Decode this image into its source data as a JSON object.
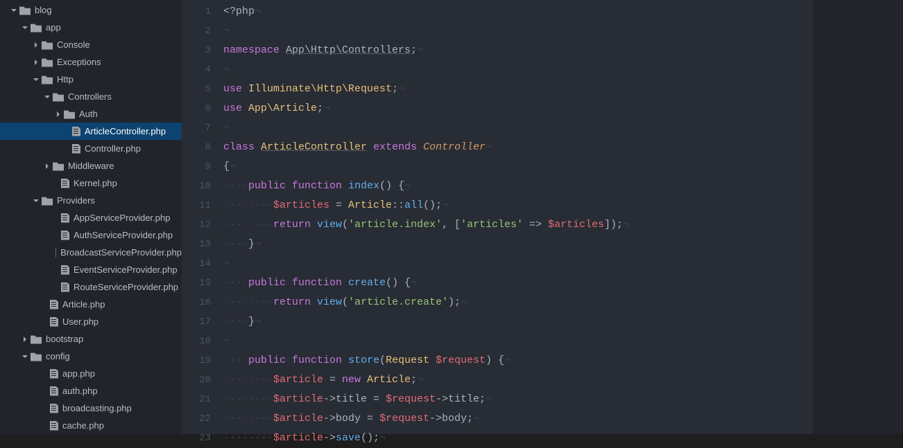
{
  "sidebar": {
    "items": [
      {
        "indent": 16,
        "arrow": "down",
        "icon": "folder-open",
        "label": "blog"
      },
      {
        "indent": 32,
        "arrow": "down",
        "icon": "folder-open",
        "label": "app"
      },
      {
        "indent": 48,
        "arrow": "right",
        "icon": "folder",
        "label": "Console"
      },
      {
        "indent": 48,
        "arrow": "right",
        "icon": "folder",
        "label": "Exceptions"
      },
      {
        "indent": 48,
        "arrow": "down",
        "icon": "folder-open",
        "label": "Http"
      },
      {
        "indent": 64,
        "arrow": "down",
        "icon": "folder-open",
        "label": "Controllers"
      },
      {
        "indent": 80,
        "arrow": "right",
        "icon": "folder",
        "label": "Auth"
      },
      {
        "indent": 92,
        "arrow": "none",
        "icon": "file",
        "label": "ArticleController.php",
        "selected": true
      },
      {
        "indent": 92,
        "arrow": "none",
        "icon": "file",
        "label": "Controller.php"
      },
      {
        "indent": 64,
        "arrow": "right",
        "icon": "folder",
        "label": "Middleware"
      },
      {
        "indent": 76,
        "arrow": "none",
        "icon": "file",
        "label": "Kernel.php"
      },
      {
        "indent": 48,
        "arrow": "down",
        "icon": "folder-open",
        "label": "Providers"
      },
      {
        "indent": 76,
        "arrow": "none",
        "icon": "file",
        "label": "AppServiceProvider.php"
      },
      {
        "indent": 76,
        "arrow": "none",
        "icon": "file",
        "label": "AuthServiceProvider.php"
      },
      {
        "indent": 76,
        "arrow": "none",
        "icon": "file",
        "label": "BroadcastServiceProvider.php"
      },
      {
        "indent": 76,
        "arrow": "none",
        "icon": "file",
        "label": "EventServiceProvider.php"
      },
      {
        "indent": 76,
        "arrow": "none",
        "icon": "file",
        "label": "RouteServiceProvider.php"
      },
      {
        "indent": 60,
        "arrow": "none",
        "icon": "file",
        "label": "Article.php"
      },
      {
        "indent": 60,
        "arrow": "none",
        "icon": "file",
        "label": "User.php"
      },
      {
        "indent": 32,
        "arrow": "right",
        "icon": "folder",
        "label": "bootstrap"
      },
      {
        "indent": 32,
        "arrow": "down",
        "icon": "folder-open",
        "label": "config"
      },
      {
        "indent": 60,
        "arrow": "none",
        "icon": "file",
        "label": "app.php"
      },
      {
        "indent": 60,
        "arrow": "none",
        "icon": "file",
        "label": "auth.php"
      },
      {
        "indent": 60,
        "arrow": "none",
        "icon": "file",
        "label": "broadcasting.php"
      },
      {
        "indent": 60,
        "arrow": "none",
        "icon": "file",
        "label": "cache.php"
      }
    ]
  },
  "editor": {
    "lines": [
      {
        "n": 1,
        "t": [
          [
            "tag",
            "<?php"
          ],
          [
            "ws",
            "¬"
          ]
        ]
      },
      {
        "n": 2,
        "t": [
          [
            "ws",
            "¬"
          ]
        ]
      },
      {
        "n": 3,
        "t": [
          [
            "kw",
            "namespace"
          ],
          [
            "op",
            " "
          ],
          [
            "ns",
            "App\\Http\\Controllers"
          ],
          [
            "op",
            ";"
          ],
          [
            "ws",
            "¬"
          ]
        ]
      },
      {
        "n": 4,
        "t": [
          [
            "ws",
            "¬"
          ]
        ]
      },
      {
        "n": 5,
        "t": [
          [
            "kw",
            "use"
          ],
          [
            "op",
            " "
          ],
          [
            "cls",
            "Illuminate\\Http\\Request"
          ],
          [
            "op",
            ";"
          ],
          [
            "ws",
            "¬"
          ]
        ]
      },
      {
        "n": 6,
        "t": [
          [
            "kw",
            "use"
          ],
          [
            "op",
            " "
          ],
          [
            "cls",
            "App\\Article"
          ],
          [
            "op",
            ";"
          ],
          [
            "ws",
            "¬"
          ]
        ]
      },
      {
        "n": 7,
        "t": [
          [
            "ws",
            "¬"
          ]
        ]
      },
      {
        "n": 8,
        "t": [
          [
            "kw",
            "class"
          ],
          [
            "op",
            " "
          ],
          [
            "clsu",
            "ArticleController"
          ],
          [
            "op",
            " "
          ],
          [
            "kw",
            "extends"
          ],
          [
            "op",
            " "
          ],
          [
            "ctrl",
            "Controller"
          ],
          [
            "ws",
            "¬"
          ]
        ]
      },
      {
        "n": 9,
        "t": [
          [
            "op",
            "{"
          ],
          [
            "ws",
            "¬"
          ]
        ]
      },
      {
        "n": 10,
        "t": [
          [
            "ws",
            "····"
          ],
          [
            "kw",
            "public"
          ],
          [
            "op",
            " "
          ],
          [
            "kw",
            "function"
          ],
          [
            "op",
            " "
          ],
          [
            "fn",
            "index"
          ],
          [
            "op",
            "() {"
          ],
          [
            "ws",
            "¬"
          ]
        ]
      },
      {
        "n": 11,
        "t": [
          [
            "ws",
            "········"
          ],
          [
            "var",
            "$articles"
          ],
          [
            "op",
            " = "
          ],
          [
            "cls",
            "Article"
          ],
          [
            "nsop",
            "::"
          ],
          [
            "fn",
            "all"
          ],
          [
            "op",
            "();"
          ],
          [
            "ws",
            "¬"
          ]
        ]
      },
      {
        "n": 12,
        "t": [
          [
            "ws",
            "········"
          ],
          [
            "kw",
            "return"
          ],
          [
            "op",
            " "
          ],
          [
            "fn",
            "view"
          ],
          [
            "op",
            "("
          ],
          [
            "str",
            "'article.index'"
          ],
          [
            "op",
            ", ["
          ],
          [
            "str",
            "'articles'"
          ],
          [
            "op",
            " => "
          ],
          [
            "var",
            "$articles"
          ],
          [
            "op",
            "]);"
          ],
          [
            "ws",
            "¬"
          ]
        ]
      },
      {
        "n": 13,
        "t": [
          [
            "ws",
            "····"
          ],
          [
            "op",
            "}"
          ],
          [
            "ws",
            "¬"
          ]
        ]
      },
      {
        "n": 14,
        "t": [
          [
            "ws",
            "¬"
          ]
        ]
      },
      {
        "n": 15,
        "t": [
          [
            "ws",
            "····"
          ],
          [
            "kw",
            "public"
          ],
          [
            "op",
            " "
          ],
          [
            "kw",
            "function"
          ],
          [
            "op",
            " "
          ],
          [
            "fn",
            "create"
          ],
          [
            "op",
            "() {"
          ],
          [
            "ws",
            "¬"
          ]
        ]
      },
      {
        "n": 16,
        "t": [
          [
            "ws",
            "········"
          ],
          [
            "kw",
            "return"
          ],
          [
            "op",
            " "
          ],
          [
            "fn",
            "view"
          ],
          [
            "op",
            "("
          ],
          [
            "str",
            "'article.create'"
          ],
          [
            "op",
            ");"
          ],
          [
            "ws",
            "¬"
          ]
        ]
      },
      {
        "n": 17,
        "t": [
          [
            "ws",
            "····"
          ],
          [
            "op",
            "}"
          ],
          [
            "ws",
            "¬"
          ]
        ]
      },
      {
        "n": 18,
        "t": [
          [
            "ws",
            "¬"
          ]
        ]
      },
      {
        "n": 19,
        "t": [
          [
            "ws",
            "····"
          ],
          [
            "kw",
            "public"
          ],
          [
            "op",
            " "
          ],
          [
            "kw",
            "function"
          ],
          [
            "op",
            " "
          ],
          [
            "fn",
            "store"
          ],
          [
            "op",
            "("
          ],
          [
            "cls",
            "Request"
          ],
          [
            "op",
            " "
          ],
          [
            "var",
            "$request"
          ],
          [
            "op",
            ") {"
          ],
          [
            "ws",
            "¬"
          ]
        ]
      },
      {
        "n": 20,
        "t": [
          [
            "ws",
            "········"
          ],
          [
            "var",
            "$article"
          ],
          [
            "op",
            " = "
          ],
          [
            "kw",
            "new"
          ],
          [
            "op",
            " "
          ],
          [
            "cls",
            "Article"
          ],
          [
            "op",
            ";"
          ],
          [
            "ws",
            "¬"
          ]
        ]
      },
      {
        "n": 21,
        "t": [
          [
            "ws",
            "········"
          ],
          [
            "var",
            "$article"
          ],
          [
            "op",
            "->"
          ],
          [
            "op",
            "title = "
          ],
          [
            "var",
            "$request"
          ],
          [
            "op",
            "->title;"
          ],
          [
            "ws",
            "¬"
          ]
        ]
      },
      {
        "n": 22,
        "t": [
          [
            "ws",
            "········"
          ],
          [
            "var",
            "$article"
          ],
          [
            "op",
            "->"
          ],
          [
            "op",
            "body = "
          ],
          [
            "var",
            "$request"
          ],
          [
            "op",
            "->body;"
          ],
          [
            "ws",
            "¬"
          ]
        ]
      },
      {
        "n": 23,
        "t": [
          [
            "ws",
            "········"
          ],
          [
            "var",
            "$article"
          ],
          [
            "op",
            "->"
          ],
          [
            "fn",
            "save"
          ],
          [
            "op",
            "();"
          ],
          [
            "ws",
            "¬"
          ]
        ]
      }
    ]
  }
}
